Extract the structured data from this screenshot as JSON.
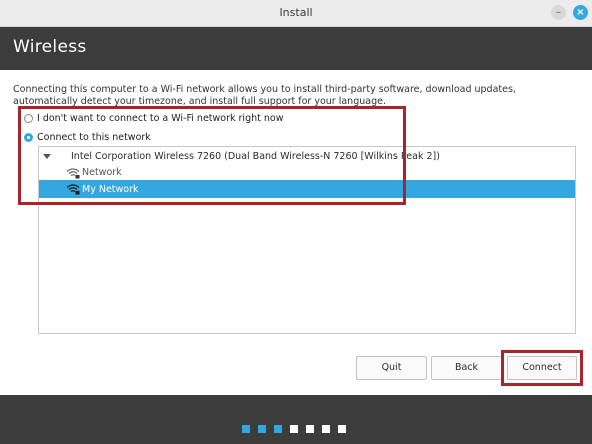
{
  "window": {
    "title": "Install",
    "minimize_icon": "minimize-icon",
    "minimize_glyph": "–",
    "close_icon": "close-icon",
    "close_glyph": "×"
  },
  "header": {
    "title": "Wireless"
  },
  "description": "Connecting this computer to a Wi-Fi network allows you to install third-party software, download updates, automatically detect your timezone, and install full support for your language.",
  "options": {
    "no_connect_label": "I don't want to connect to a Wi-Fi network right now",
    "connect_label": "Connect to this network",
    "selected": "connect"
  },
  "network_list": {
    "device": "Intel Corporation Wireless 7260 (Dual Band Wireless-N 7260 [Wilkins Peak 2])",
    "networks": [
      {
        "name": "Network",
        "icon": "wifi-lock-icon",
        "selected": false
      },
      {
        "name": "My Network",
        "icon": "wifi-lock-icon",
        "selected": true
      }
    ]
  },
  "buttons": {
    "quit": "Quit",
    "back": "Back",
    "connect": "Connect"
  },
  "progress": {
    "total_steps": 7,
    "completed_steps": 3
  },
  "colors": {
    "accent": "#35a7e0",
    "header_bg": "#3c3c3c",
    "highlight": "#a8252b"
  }
}
